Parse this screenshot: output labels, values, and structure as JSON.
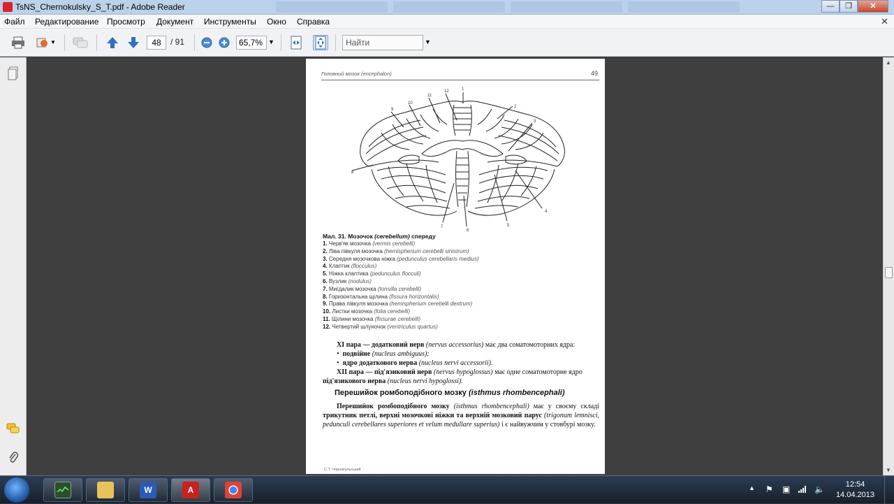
{
  "window": {
    "title": "TsNS_Chernokulsky_S_T.pdf - Adobe Reader",
    "minimize": "—",
    "maximize": "❐",
    "close": "✕"
  },
  "menu": {
    "items": [
      "Файл",
      "Редактирование",
      "Просмотр",
      "Документ",
      "Инструменты",
      "Окно",
      "Справка"
    ],
    "close_doc": "✕"
  },
  "toolbar": {
    "current_page": "48",
    "total_pages": "/ 91",
    "zoom": "65,7%",
    "find_placeholder": "Найти"
  },
  "page": {
    "header_left": "Головний мозок (encephalon)",
    "page_number": "49",
    "figure_labels": [
      "1",
      "2",
      "3",
      "4",
      "5",
      "6",
      "7",
      "8",
      "9",
      "10",
      "11",
      "12"
    ],
    "caption_title_prefix": "Мал. 31. Мозочок ",
    "caption_title_latin": "(cerebellum)",
    "caption_title_suffix": " спереду",
    "legend": [
      {
        "num": "1.",
        "ua": "Черв'як мозочка",
        "lat": "(vermis cerebelli)"
      },
      {
        "num": "2.",
        "ua": "Ліва півкуля мозочка",
        "lat": "(hemispherium cerebelli sinistrum)"
      },
      {
        "num": "3.",
        "ua": "Середня мозочкова ніжка",
        "lat": "(pedunculus cerebellaris medius)"
      },
      {
        "num": "4.",
        "ua": "Клаптик",
        "lat": "(flocculus)"
      },
      {
        "num": "5.",
        "ua": "Ніжка клаптика",
        "lat": "(pedunculus flocculi)"
      },
      {
        "num": "6.",
        "ua": "Вузлик",
        "lat": "(nodulus)"
      },
      {
        "num": "7.",
        "ua": "Мигдалик мозочка",
        "lat": "(tonsilla cerebelli)"
      },
      {
        "num": "8.",
        "ua": "Горизонтальна щілина",
        "lat": "(fissura horizontalis)"
      },
      {
        "num": "9.",
        "ua": "Права півкуля мозочка",
        "lat": "(hemispherium cerebelli dextrum)"
      },
      {
        "num": "10.",
        "ua": "Листки мозочка",
        "lat": "(folia cerebelli)"
      },
      {
        "num": "11.",
        "ua": "Щілини мозочка",
        "lat": "(fissurae cerebelli)"
      },
      {
        "num": "12.",
        "ua": "Четвертий шлуночок",
        "lat": "(ventriculus quartus)"
      }
    ],
    "p1_bold": "XI пара — додатковий нерв",
    "p1_lat": "(nervus accessorius)",
    "p1_rest": "має два соматомоторних ядра:",
    "b1_bold": "подвійне",
    "b1_lat": "(nucleus ambiguus);",
    "b2_bold": "ядро додаткового нерва",
    "b2_lat": "(nucleus nervi accessorii).",
    "p2_bold": "XII пара — під'язиковий нерв",
    "p2_lat": "(nervus hypoglossus)",
    "p2_rest": "має одне соматомоторне ядро",
    "p2_bold2": "під'язикового нерва",
    "p2_lat2": "(nucleus nervi hypoglossi).",
    "section_title_prefix": "Перешийок ромбоподібного мозку ",
    "section_title_latin": "(isthmus rhombencephali)",
    "p3_bold": "Перешийок ромбоподібного мозку",
    "p3_lat": "(isthmus rhombencephali)",
    "p3_a": "має у своєму складі",
    "p3_bold2": "трикутник петлі, верхні мозочкові ніжки та верхній мозковий парус",
    "p3_lat2": "(trigonum lemnisci, pedunculi cerebellares superiores et velum medullare superius)",
    "p3_b": "і є найвужчим у стовбурі мозку.",
    "footer": "С.Т. Чорнокульський"
  },
  "taskbar": {
    "clock_time": "12:54",
    "clock_date": "14.04.2013"
  }
}
